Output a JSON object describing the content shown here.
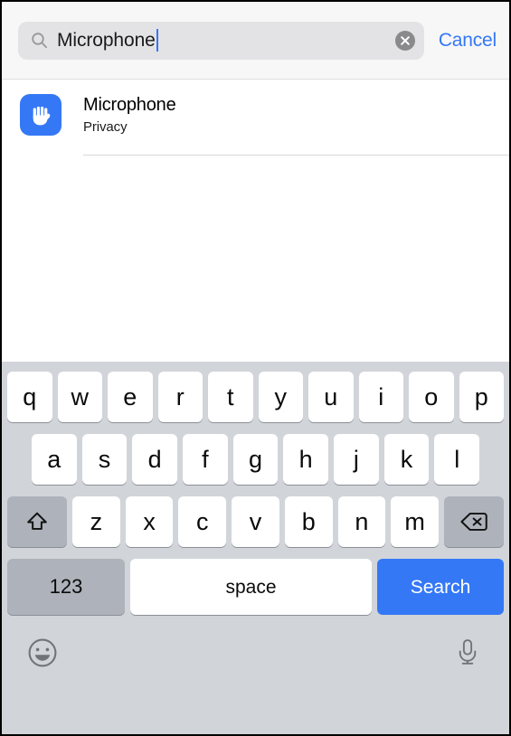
{
  "search": {
    "value": "Microphone",
    "placeholder": "Search",
    "search_icon": "search-icon",
    "clear_icon": "clear-circle-icon",
    "cancel_label": "Cancel"
  },
  "results": [
    {
      "icon": "hand-privacy-icon",
      "icon_color": "#3478f6",
      "title": "Microphone",
      "subtitle": "Privacy"
    }
  ],
  "keyboard": {
    "row1": [
      "q",
      "w",
      "e",
      "r",
      "t",
      "y",
      "u",
      "i",
      "o",
      "p"
    ],
    "row2": [
      "a",
      "s",
      "d",
      "f",
      "g",
      "h",
      "j",
      "k",
      "l"
    ],
    "row3": [
      "z",
      "x",
      "c",
      "v",
      "b",
      "n",
      "m"
    ],
    "shift_icon": "shift-arrow-icon",
    "backspace_icon": "backspace-delete-icon",
    "numbers_label": "123",
    "space_label": "space",
    "search_label": "Search",
    "emoji_icon": "emoji-smiley-icon",
    "dictation_icon": "microphone-icon"
  },
  "colors": {
    "accent_blue": "#3478f6",
    "keyboard_bg": "#d1d5da",
    "key_white": "#ffffff",
    "key_gray": "#aeb3bb",
    "search_field_bg": "#e3e3e5",
    "header_bg": "#f7f7f7"
  }
}
